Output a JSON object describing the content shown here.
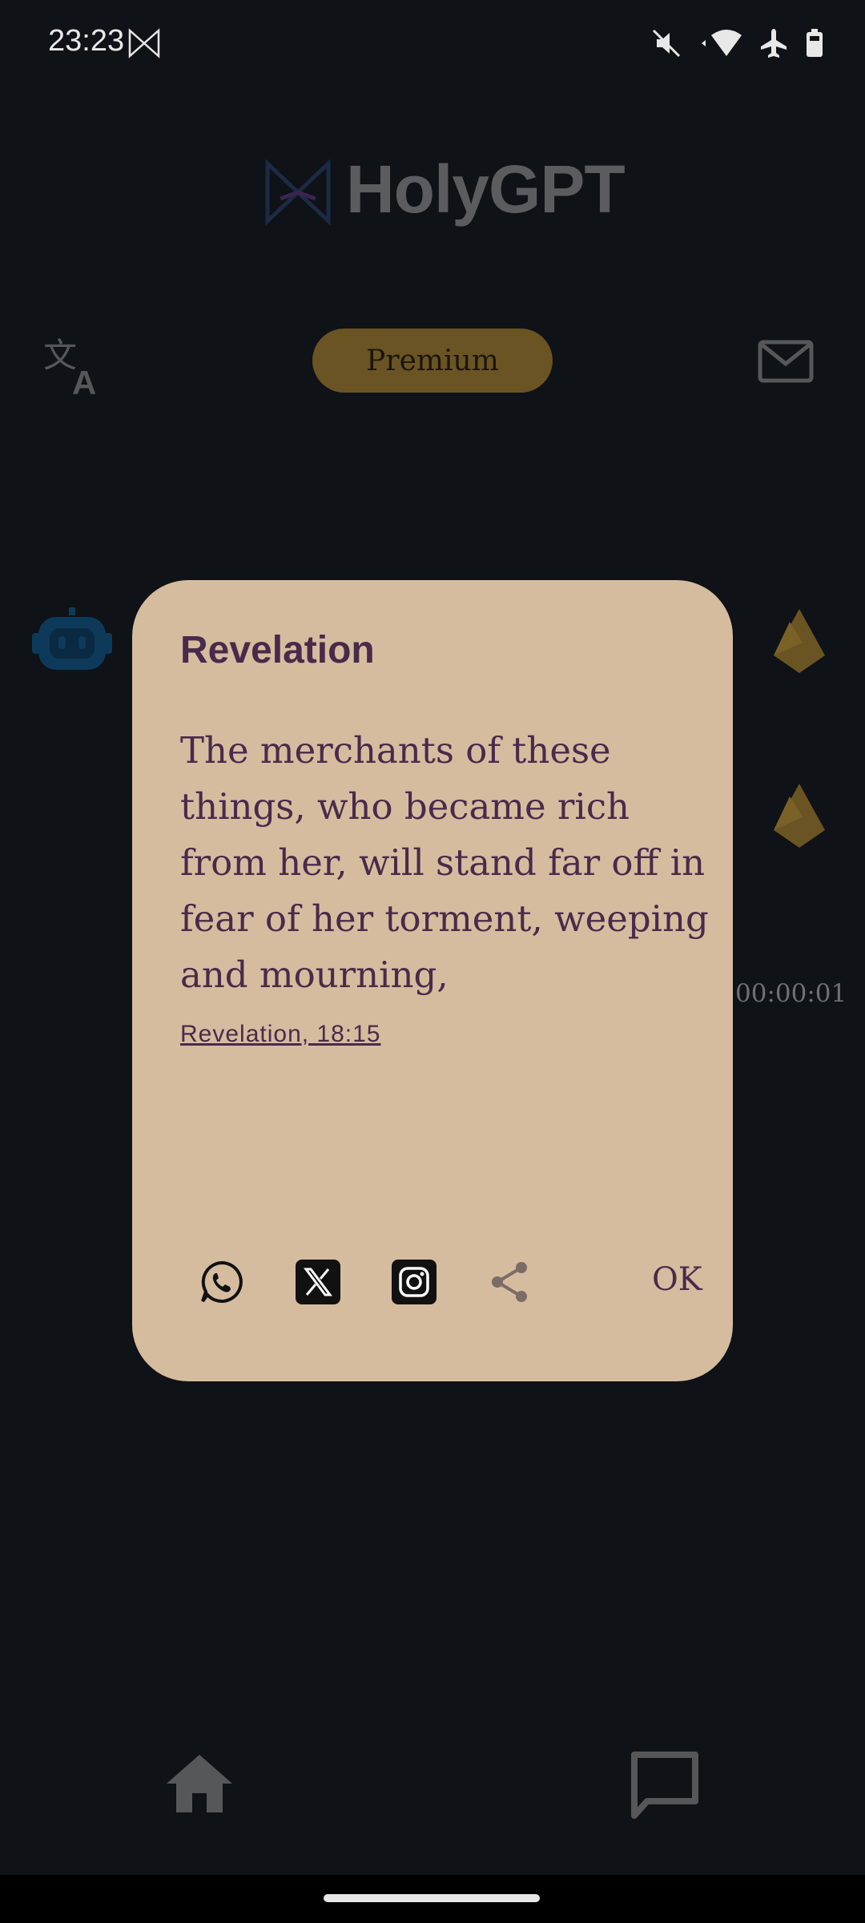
{
  "status_bar": {
    "time": "23:23"
  },
  "header": {
    "title": "HolyGPT",
    "premium_label": "Premium"
  },
  "background": {
    "timer": "00:00:01"
  },
  "dialog": {
    "title": "Revelation",
    "verse": "The merchants of these things, who became rich from her, will stand far off in fear of her torment, weeping and mourning,",
    "reference": "Revelation, 18:15",
    "ok_label": "OK"
  },
  "icons": {
    "share": [
      "whatsapp-icon",
      "x-icon",
      "instagram-icon",
      "share-icon"
    ]
  },
  "colors": {
    "dialog_bg": "#d6bc9f",
    "dialog_text": "#4a2a4a",
    "premium_bg": "#6b5423",
    "background": "#0f1216"
  }
}
